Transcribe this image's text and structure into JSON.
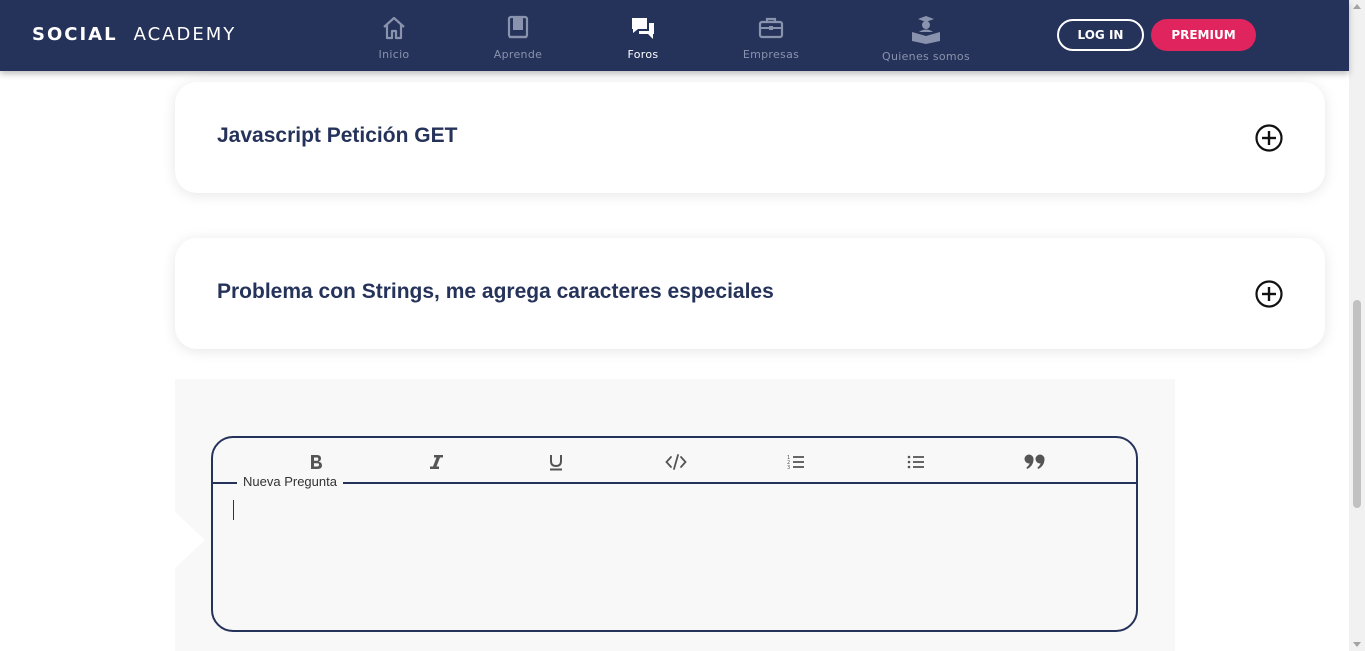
{
  "header": {
    "logo_part1": "SOCIAL",
    "logo_part2": "ACADEMY",
    "nav": [
      {
        "label": "Inicio",
        "icon": "home-icon",
        "active": false
      },
      {
        "label": "Aprende",
        "icon": "book-icon",
        "active": false
      },
      {
        "label": "Foros",
        "icon": "forum-chat-icon",
        "active": true
      },
      {
        "label": "Empresas",
        "icon": "briefcase-icon",
        "active": false
      },
      {
        "label": "Quienes somos",
        "icon": "graduate-reading-icon",
        "active": false
      }
    ],
    "login_label": "LOG IN",
    "premium_label": "PREMIUM"
  },
  "questions": [
    {
      "title": "Javascript Petición GET",
      "toggle_icon": "plus-circle-icon"
    },
    {
      "title": "Problema con Strings, me agrega caracteres especiales",
      "toggle_icon": "plus-circle-icon"
    }
  ],
  "editor": {
    "legend": "Nueva Pregunta",
    "value": "",
    "toolbar": [
      "bold-icon",
      "italic-icon",
      "underline-icon",
      "code-icon",
      "ordered-list-icon",
      "bullet-list-icon",
      "quote-icon"
    ]
  },
  "colors": {
    "header_bg": "#25325a",
    "accent": "#e0245e",
    "title": "#25325a",
    "editor_bg": "#f8f8f8"
  }
}
